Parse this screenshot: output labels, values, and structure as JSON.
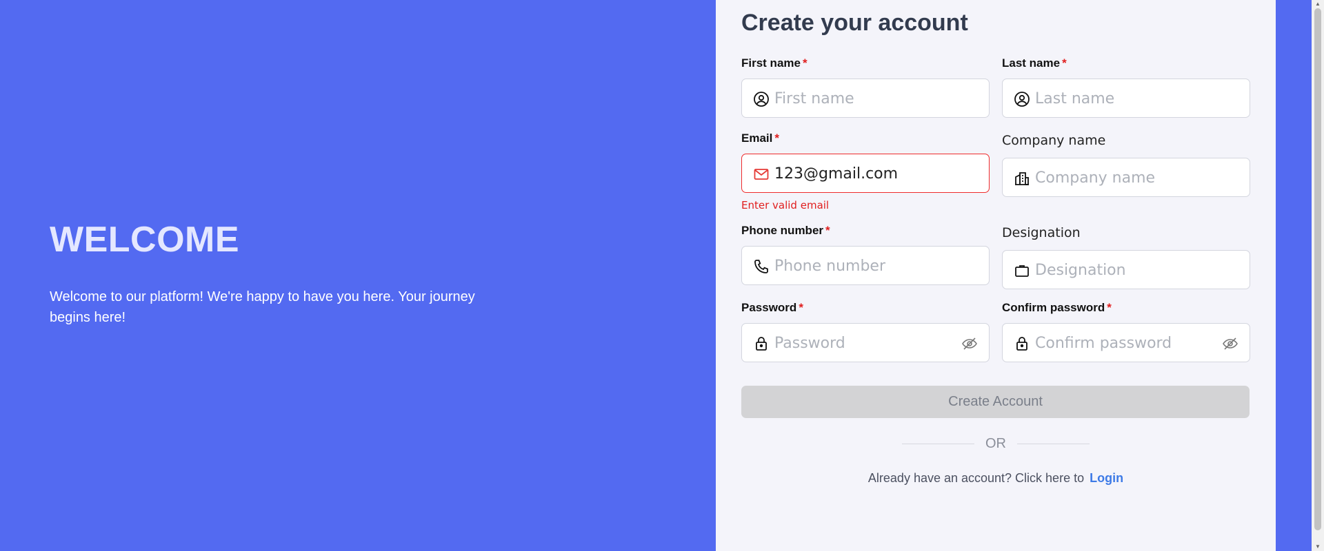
{
  "welcome": {
    "heading": "WELCOME",
    "text": "Welcome to our platform! We're happy to have you here. Your journey begins here!"
  },
  "form": {
    "title": "Create your account",
    "required_mark": "*",
    "first_name": {
      "label": "First name",
      "placeholder": "First name",
      "icon": "user-circle-icon"
    },
    "last_name": {
      "label": "Last name",
      "placeholder": "Last name",
      "icon": "user-circle-icon"
    },
    "email": {
      "label": "Email",
      "value": "123@gmail.com",
      "icon": "mail-icon",
      "error": "Enter valid email"
    },
    "company": {
      "label": "Company name",
      "placeholder": "Company name",
      "icon": "building-icon"
    },
    "phone": {
      "label": "Phone number",
      "placeholder": "Phone number",
      "icon": "phone-icon"
    },
    "designation": {
      "label": "Designation",
      "placeholder": "Designation",
      "icon": "briefcase-icon"
    },
    "password": {
      "label": "Password",
      "placeholder": "Password",
      "icon": "lock-icon",
      "toggle_icon": "eye-off-icon"
    },
    "confirm_password": {
      "label": "Confirm password",
      "placeholder": "Confirm password",
      "icon": "lock-icon",
      "toggle_icon": "eye-off-icon"
    },
    "submit_label": "Create Account",
    "divider_text": "OR",
    "footer_text": "Already have an account? Click here to",
    "login_link": "Login"
  },
  "colors": {
    "background": "#536af1",
    "panel": "#f4f4fa",
    "error": "#e01e1e",
    "link": "#3d7ae6",
    "button_disabled": "#d3d3d5"
  }
}
